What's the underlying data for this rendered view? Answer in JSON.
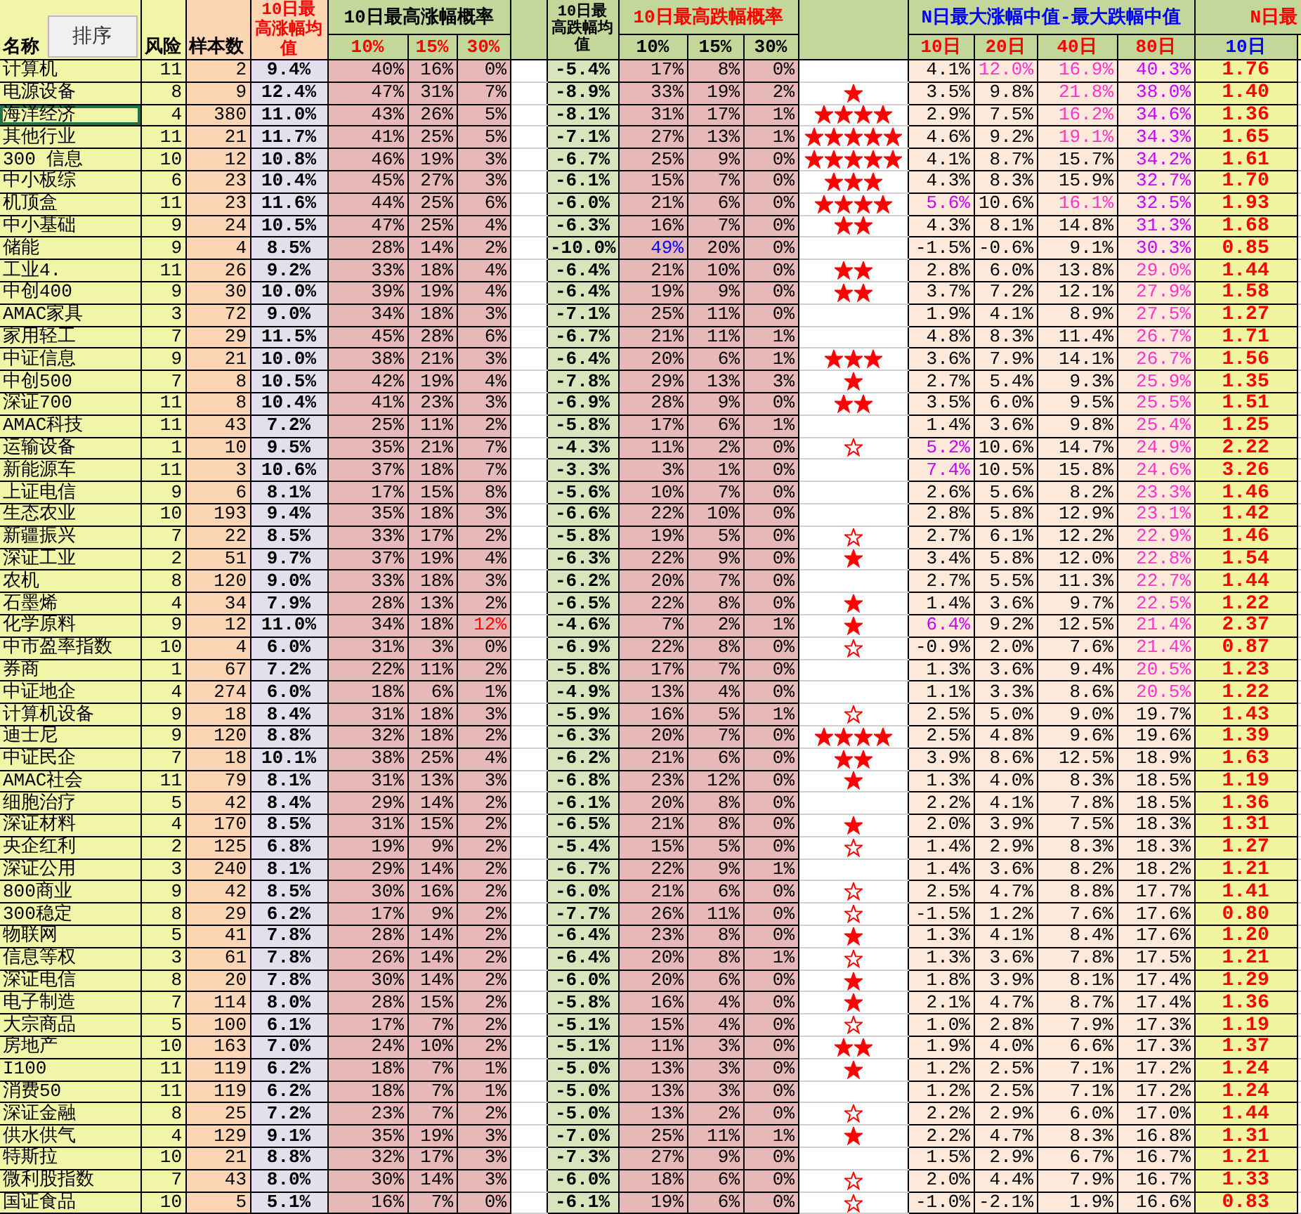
{
  "header": {
    "sort_button": "排序",
    "name": "名称",
    "risk": "风险",
    "count": "样本数",
    "up_mean": "10日最高涨幅均值",
    "up_prob": {
      "title": "10日最高涨幅概率",
      "cols": [
        "10%",
        "15%",
        "30%"
      ]
    },
    "down_mean": "10日最高跌幅均值",
    "down_prob": {
      "title": "10日最高跌幅概率",
      "cols": [
        "10%",
        "15%",
        "30%"
      ]
    },
    "median": {
      "title": "N日最大涨幅中值-最大跌幅中值",
      "cols": [
        "10日",
        "20日",
        "40日",
        "80日"
      ]
    },
    "ratio": {
      "title": "N日最",
      "cols": [
        "10日"
      ]
    }
  },
  "rows": [
    {
      "name": "计算机",
      "selected": false,
      "risk": "11",
      "count": "2",
      "up_mean": "9.4%",
      "up_prob": [
        "40%",
        "16%",
        "0%"
      ],
      "down_mean": "-5.4%",
      "down_prob": [
        "17%",
        "8%",
        "0%"
      ],
      "median": [
        "4.1%",
        {
          "text": "12.0%",
          "color": "#ff33cc"
        },
        {
          "text": "16.9%",
          "color": "#ff33cc"
        },
        {
          "text": "40.3%",
          "color": "#cc00ff"
        }
      ],
      "ratio": "1.76"
    },
    {
      "name": "电源设备",
      "selected": false,
      "risk": "8",
      "count": "9",
      "up_mean": "12.4%",
      "up_prob": [
        "47%",
        "31%",
        "7%"
      ],
      "down_mean": "-8.9%",
      "down_prob": [
        "33%",
        "19%",
        "2%"
      ],
      "star_icons": [
        {
          "filled": true
        }
      ],
      "median": [
        "3.5%",
        "9.8%",
        {
          "text": "21.8%",
          "color": "#ff33cc"
        },
        {
          "text": "38.0%",
          "color": "#cc00ff"
        }
      ],
      "ratio": "1.40"
    },
    {
      "name": "海洋经济",
      "selected": true,
      "risk": "4",
      "count": "380",
      "up_mean": "11.0%",
      "up_prob": [
        "43%",
        "26%",
        "5%"
      ],
      "down_mean": "-8.1%",
      "down_prob": [
        "31%",
        "17%",
        "1%"
      ],
      "star_icons": [
        {
          "filled": true
        },
        {
          "filled": true
        },
        {
          "filled": true
        },
        {
          "filled": true
        }
      ],
      "median": [
        "2.9%",
        "7.5%",
        {
          "text": "16.2%",
          "color": "#ff33cc"
        },
        {
          "text": "34.6%",
          "color": "#cc00ff"
        }
      ],
      "ratio": "1.36"
    },
    {
      "name": "其他行业",
      "selected": false,
      "risk": "11",
      "count": "21",
      "up_mean": "11.7%",
      "up_prob": [
        "41%",
        "25%",
        "5%"
      ],
      "down_mean": "-7.1%",
      "down_prob": [
        "27%",
        "13%",
        "1%"
      ],
      "star_icons": [
        {
          "filled": true
        },
        {
          "filled": true
        },
        {
          "filled": true
        },
        {
          "filled": true
        },
        {
          "filled": true
        }
      ],
      "median": [
        "4.6%",
        "9.2%",
        {
          "text": "19.1%",
          "color": "#ff33cc"
        },
        {
          "text": "34.3%",
          "color": "#cc00ff"
        }
      ],
      "ratio": "1.65"
    },
    {
      "name": "300 信息",
      "selected": false,
      "risk": "10",
      "count": "12",
      "up_mean": "10.8%",
      "up_prob": [
        "46%",
        "19%",
        "3%"
      ],
      "down_mean": "-6.7%",
      "down_prob": [
        "25%",
        "9%",
        "0%"
      ],
      "star_icons": [
        {
          "filled": true
        },
        {
          "filled": true
        },
        {
          "filled": true
        },
        {
          "filled": true
        },
        {
          "filled": true
        }
      ],
      "median": [
        "4.1%",
        "8.7%",
        "15.7%",
        {
          "text": "34.2%",
          "color": "#cc00ff"
        }
      ],
      "ratio": "1.61"
    },
    {
      "name": "中小板综",
      "selected": false,
      "risk": "6",
      "count": "23",
      "up_mean": "10.4%",
      "up_prob": [
        "45%",
        "27%",
        "3%"
      ],
      "down_mean": "-6.1%",
      "down_prob": [
        "15%",
        "7%",
        "0%"
      ],
      "star_icons": [
        {
          "filled": true
        },
        {
          "filled": true
        },
        {
          "filled": true
        }
      ],
      "median": [
        "4.3%",
        "8.3%",
        "15.9%",
        {
          "text": "32.7%",
          "color": "#cc00ff"
        }
      ],
      "ratio": "1.70"
    },
    {
      "name": "机顶盒",
      "selected": false,
      "risk": "11",
      "count": "23",
      "up_mean": "11.6%",
      "up_prob": [
        "44%",
        "25%",
        "6%"
      ],
      "down_mean": "-6.0%",
      "down_prob": [
        "21%",
        "6%",
        "0%"
      ],
      "star_icons": [
        {
          "filled": true
        },
        {
          "filled": true
        },
        {
          "filled": true
        },
        {
          "filled": true
        }
      ],
      "median": [
        {
          "text": "5.6%",
          "color": "#cc00ff"
        },
        "10.6%",
        {
          "text": "16.1%",
          "color": "#ff33cc"
        },
        {
          "text": "32.5%",
          "color": "#cc00ff"
        }
      ],
      "ratio": "1.93"
    },
    {
      "name": "中小基础",
      "selected": false,
      "risk": "9",
      "count": "24",
      "up_mean": "10.5%",
      "up_prob": [
        "47%",
        "25%",
        "4%"
      ],
      "down_mean": "-6.3%",
      "down_prob": [
        "16%",
        "7%",
        "0%"
      ],
      "star_icons": [
        {
          "filled": true
        },
        {
          "filled": true
        }
      ],
      "median": [
        "4.3%",
        "8.1%",
        "14.8%",
        {
          "text": "31.3%",
          "color": "#cc00ff"
        }
      ],
      "ratio": "1.68"
    },
    {
      "name": "储能",
      "selected": false,
      "risk": "9",
      "count": "4",
      "up_mean": "8.5%",
      "up_prob": [
        "28%",
        "14%",
        "2%"
      ],
      "down_mean": "-10.0%",
      "down_prob": [
        {
          "text": "49%",
          "color": "#0000ff"
        },
        "20%",
        "0%"
      ],
      "median": [
        "-1.5%",
        "-0.6%",
        "9.1%",
        {
          "text": "30.3%",
          "color": "#cc00ff"
        }
      ],
      "ratio": "0.85"
    },
    {
      "name": "工业4.",
      "selected": false,
      "risk": "11",
      "count": "26",
      "up_mean": "9.2%",
      "up_prob": [
        "33%",
        "18%",
        "4%"
      ],
      "down_mean": "-6.4%",
      "down_prob": [
        "21%",
        "10%",
        "0%"
      ],
      "star_icons": [
        {
          "filled": true
        },
        {
          "filled": true
        }
      ],
      "median": [
        "2.8%",
        "6.0%",
        "13.8%",
        {
          "text": "29.0%",
          "color": "#ff33cc"
        }
      ],
      "ratio": "1.44"
    },
    {
      "name": "中创400",
      "selected": false,
      "risk": "9",
      "count": "30",
      "up_mean": "10.0%",
      "up_prob": [
        "39%",
        "19%",
        "4%"
      ],
      "down_mean": "-6.4%",
      "down_prob": [
        "19%",
        "9%",
        "0%"
      ],
      "star_icons": [
        {
          "filled": true
        },
        {
          "filled": true
        }
      ],
      "median": [
        "3.7%",
        "7.2%",
        "12.1%",
        {
          "text": "27.9%",
          "color": "#ff33cc"
        }
      ],
      "ratio": "1.58"
    },
    {
      "name": "AMAC家具",
      "selected": false,
      "risk": "3",
      "count": "72",
      "up_mean": "9.0%",
      "up_prob": [
        "34%",
        "18%",
        "3%"
      ],
      "down_mean": "-7.1%",
      "down_prob": [
        "25%",
        "11%",
        "0%"
      ],
      "median": [
        "1.9%",
        "4.1%",
        "8.9%",
        {
          "text": "27.5%",
          "color": "#ff33cc"
        }
      ],
      "ratio": "1.27"
    },
    {
      "name": "家用轻工",
      "selected": false,
      "risk": "7",
      "count": "29",
      "up_mean": "11.5%",
      "up_prob": [
        "45%",
        "28%",
        "6%"
      ],
      "down_mean": "-6.7%",
      "down_prob": [
        "21%",
        "11%",
        "1%"
      ],
      "median": [
        "4.8%",
        "8.3%",
        "11.4%",
        {
          "text": "26.7%",
          "color": "#ff33cc"
        }
      ],
      "ratio": "1.71"
    },
    {
      "name": "中证信息",
      "selected": false,
      "risk": "9",
      "count": "21",
      "up_mean": "10.0%",
      "up_prob": [
        "38%",
        "21%",
        "3%"
      ],
      "down_mean": "-6.4%",
      "down_prob": [
        "20%",
        "6%",
        "1%"
      ],
      "star_icons": [
        {
          "filled": true
        },
        {
          "filled": true
        },
        {
          "filled": true
        }
      ],
      "median": [
        "3.6%",
        "7.9%",
        "14.1%",
        {
          "text": "26.7%",
          "color": "#ff33cc"
        }
      ],
      "ratio": "1.56"
    },
    {
      "name": "中创500",
      "selected": false,
      "risk": "7",
      "count": "8",
      "up_mean": "10.5%",
      "up_prob": [
        "42%",
        "19%",
        "4%"
      ],
      "down_mean": "-7.8%",
      "down_prob": [
        "29%",
        "13%",
        "3%"
      ],
      "star_icons": [
        {
          "filled": true
        }
      ],
      "median": [
        "2.7%",
        "5.4%",
        "9.3%",
        {
          "text": "25.9%",
          "color": "#ff33cc"
        }
      ],
      "ratio": "1.35"
    },
    {
      "name": "深证700",
      "selected": false,
      "risk": "11",
      "count": "8",
      "up_mean": "10.4%",
      "up_prob": [
        "41%",
        "23%",
        "3%"
      ],
      "down_mean": "-6.9%",
      "down_prob": [
        "28%",
        "9%",
        "0%"
      ],
      "star_icons": [
        {
          "filled": true
        },
        {
          "filled": true
        }
      ],
      "median": [
        "3.5%",
        "6.0%",
        "9.5%",
        {
          "text": "25.5%",
          "color": "#ff33cc"
        }
      ],
      "ratio": "1.51"
    },
    {
      "name": "AMAC科技",
      "selected": false,
      "risk": "11",
      "count": "43",
      "up_mean": "7.2%",
      "up_prob": [
        "25%",
        "11%",
        "2%"
      ],
      "down_mean": "-5.8%",
      "down_prob": [
        "17%",
        "6%",
        "1%"
      ],
      "median": [
        "1.4%",
        "3.6%",
        "9.8%",
        {
          "text": "25.4%",
          "color": "#ff33cc"
        }
      ],
      "ratio": "1.25"
    },
    {
      "name": "运输设备",
      "selected": false,
      "risk": "1",
      "count": "10",
      "up_mean": "9.5%",
      "up_prob": [
        "35%",
        "21%",
        "7%"
      ],
      "down_mean": "-4.3%",
      "down_prob": [
        "11%",
        "2%",
        "0%"
      ],
      "star_icons": [
        {
          "filled": false
        }
      ],
      "median": [
        {
          "text": "5.2%",
          "color": "#cc00ff"
        },
        "10.6%",
        "14.7%",
        {
          "text": "24.9%",
          "color": "#ff33cc"
        }
      ],
      "ratio": "2.22"
    },
    {
      "name": "新能源车",
      "selected": false,
      "risk": "11",
      "count": "3",
      "up_mean": "10.6%",
      "up_prob": [
        "37%",
        "18%",
        "7%"
      ],
      "down_mean": "-3.3%",
      "down_prob": [
        "3%",
        "1%",
        "0%"
      ],
      "median": [
        {
          "text": "7.4%",
          "color": "#cc00ff"
        },
        "10.5%",
        "15.8%",
        {
          "text": "24.6%",
          "color": "#ff33cc"
        }
      ],
      "ratio": "3.26"
    },
    {
      "name": "上证电信",
      "selected": false,
      "risk": "9",
      "count": "6",
      "up_mean": "8.1%",
      "up_prob": [
        "17%",
        "15%",
        "8%"
      ],
      "down_mean": "-5.6%",
      "down_prob": [
        "10%",
        "7%",
        "0%"
      ],
      "median": [
        "2.6%",
        "5.6%",
        "8.2%",
        {
          "text": "23.3%",
          "color": "#ff33cc"
        }
      ],
      "ratio": "1.46"
    },
    {
      "name": "生态农业",
      "selected": false,
      "risk": "10",
      "count": "193",
      "up_mean": "9.4%",
      "up_prob": [
        "35%",
        "18%",
        "3%"
      ],
      "down_mean": "-6.6%",
      "down_prob": [
        "22%",
        "10%",
        "0%"
      ],
      "median": [
        "2.8%",
        "5.8%",
        "12.9%",
        {
          "text": "23.1%",
          "color": "#ff33cc"
        }
      ],
      "ratio": "1.42"
    },
    {
      "name": "新疆振兴",
      "selected": false,
      "risk": "7",
      "count": "22",
      "up_mean": "8.5%",
      "up_prob": [
        "33%",
        "17%",
        "2%"
      ],
      "down_mean": "-5.8%",
      "down_prob": [
        "19%",
        "5%",
        "0%"
      ],
      "star_icons": [
        {
          "filled": false
        }
      ],
      "median": [
        "2.7%",
        "6.1%",
        "12.2%",
        {
          "text": "22.9%",
          "color": "#ff33cc"
        }
      ],
      "ratio": "1.46"
    },
    {
      "name": "深证工业",
      "selected": false,
      "risk": "2",
      "count": "51",
      "up_mean": "9.7%",
      "up_prob": [
        "37%",
        "19%",
        "4%"
      ],
      "down_mean": "-6.3%",
      "down_prob": [
        "22%",
        "9%",
        "0%"
      ],
      "star_icons": [
        {
          "filled": true
        }
      ],
      "median": [
        "3.4%",
        "5.8%",
        "12.0%",
        {
          "text": "22.8%",
          "color": "#ff33cc"
        }
      ],
      "ratio": "1.54"
    },
    {
      "name": "农机",
      "selected": false,
      "risk": "8",
      "count": "120",
      "up_mean": "9.0%",
      "up_prob": [
        "33%",
        "18%",
        "3%"
      ],
      "down_mean": "-6.2%",
      "down_prob": [
        "20%",
        "7%",
        "0%"
      ],
      "median": [
        "2.7%",
        "5.5%",
        "11.3%",
        {
          "text": "22.7%",
          "color": "#ff33cc"
        }
      ],
      "ratio": "1.44"
    },
    {
      "name": "石墨烯",
      "selected": false,
      "risk": "4",
      "count": "34",
      "up_mean": "7.9%",
      "up_prob": [
        "28%",
        "13%",
        "2%"
      ],
      "down_mean": "-6.5%",
      "down_prob": [
        "22%",
        "8%",
        "0%"
      ],
      "star_icons": [
        {
          "filled": true
        }
      ],
      "median": [
        "1.4%",
        "3.6%",
        "9.7%",
        {
          "text": "22.5%",
          "color": "#ff33cc"
        }
      ],
      "ratio": "1.22"
    },
    {
      "name": "化学原料",
      "selected": false,
      "risk": "9",
      "count": "12",
      "up_mean": "11.0%",
      "up_prob": [
        "34%",
        "18%",
        {
          "text": "12%",
          "color": "#ff0000"
        }
      ],
      "down_mean": "-4.6%",
      "down_prob": [
        "7%",
        "2%",
        "1%"
      ],
      "star_icons": [
        {
          "filled": true
        }
      ],
      "median": [
        {
          "text": "6.4%",
          "color": "#cc00ff"
        },
        "9.2%",
        "12.5%",
        {
          "text": "21.4%",
          "color": "#ff33cc"
        }
      ],
      "ratio": "2.37"
    },
    {
      "name": "中市盈率指数",
      "selected": false,
      "risk": "10",
      "count": "4",
      "up_mean": "6.0%",
      "up_prob": [
        "31%",
        "3%",
        "0%"
      ],
      "down_mean": "-6.9%",
      "down_prob": [
        "22%",
        "8%",
        "0%"
      ],
      "star_icons": [
        {
          "filled": false
        }
      ],
      "median": [
        "-0.9%",
        "2.0%",
        "7.6%",
        {
          "text": "21.4%",
          "color": "#ff33cc"
        }
      ],
      "ratio": "0.87"
    },
    {
      "name": "券商",
      "selected": false,
      "risk": "1",
      "count": "67",
      "up_mean": "7.2%",
      "up_prob": [
        "22%",
        "11%",
        "2%"
      ],
      "down_mean": "-5.8%",
      "down_prob": [
        "17%",
        "7%",
        "0%"
      ],
      "median": [
        "1.3%",
        "3.6%",
        "9.4%",
        {
          "text": "20.5%",
          "color": "#ff33cc"
        }
      ],
      "ratio": "1.23"
    },
    {
      "name": "中证地企",
      "selected": false,
      "risk": "4",
      "count": "274",
      "up_mean": "6.0%",
      "up_prob": [
        "18%",
        "6%",
        "1%"
      ],
      "down_mean": "-4.9%",
      "down_prob": [
        "13%",
        "4%",
        "0%"
      ],
      "median": [
        "1.1%",
        "3.3%",
        "8.6%",
        {
          "text": "20.5%",
          "color": "#ff33cc"
        }
      ],
      "ratio": "1.22"
    },
    {
      "name": "计算机设备",
      "selected": false,
      "risk": "9",
      "count": "18",
      "up_mean": "8.4%",
      "up_prob": [
        "31%",
        "18%",
        "3%"
      ],
      "down_mean": "-5.9%",
      "down_prob": [
        "16%",
        "5%",
        "1%"
      ],
      "star_icons": [
        {
          "filled": false
        }
      ],
      "median": [
        "2.5%",
        "5.0%",
        "9.0%",
        "19.7%"
      ],
      "ratio": "1.43"
    },
    {
      "name": "迪士尼",
      "selected": false,
      "risk": "9",
      "count": "120",
      "up_mean": "8.8%",
      "up_prob": [
        "32%",
        "18%",
        "2%"
      ],
      "down_mean": "-6.3%",
      "down_prob": [
        "20%",
        "7%",
        "0%"
      ],
      "star_icons": [
        {
          "filled": true
        },
        {
          "filled": true
        },
        {
          "filled": true
        },
        {
          "filled": true
        }
      ],
      "median": [
        "2.5%",
        "4.8%",
        "9.6%",
        "19.6%"
      ],
      "ratio": "1.39"
    },
    {
      "name": "中证民企",
      "selected": false,
      "risk": "7",
      "count": "18",
      "up_mean": "10.1%",
      "up_prob": [
        "38%",
        "25%",
        "4%"
      ],
      "down_mean": "-6.2%",
      "down_prob": [
        "21%",
        "6%",
        "0%"
      ],
      "star_icons": [
        {
          "filled": true
        },
        {
          "filled": true
        }
      ],
      "median": [
        "3.9%",
        "8.6%",
        "12.5%",
        "18.9%"
      ],
      "ratio": "1.63"
    },
    {
      "name": "AMAC社会",
      "selected": false,
      "risk": "11",
      "count": "79",
      "up_mean": "8.1%",
      "up_prob": [
        "31%",
        "13%",
        "3%"
      ],
      "down_mean": "-6.8%",
      "down_prob": [
        "23%",
        "12%",
        "0%"
      ],
      "star_icons": [
        {
          "filled": true
        }
      ],
      "median": [
        "1.3%",
        "4.0%",
        "8.3%",
        "18.5%"
      ],
      "ratio": "1.19"
    },
    {
      "name": "细胞治疗",
      "selected": false,
      "risk": "5",
      "count": "42",
      "up_mean": "8.4%",
      "up_prob": [
        "29%",
        "14%",
        "2%"
      ],
      "down_mean": "-6.1%",
      "down_prob": [
        "20%",
        "8%",
        "0%"
      ],
      "median": [
        "2.2%",
        "4.1%",
        "7.8%",
        "18.5%"
      ],
      "ratio": "1.36"
    },
    {
      "name": "深证材料",
      "selected": false,
      "risk": "4",
      "count": "170",
      "up_mean": "8.5%",
      "up_prob": [
        "31%",
        "15%",
        "2%"
      ],
      "down_mean": "-6.5%",
      "down_prob": [
        "21%",
        "8%",
        "0%"
      ],
      "star_icons": [
        {
          "filled": true
        }
      ],
      "median": [
        "2.0%",
        "3.9%",
        "7.5%",
        "18.3%"
      ],
      "ratio": "1.31"
    },
    {
      "name": "央企红利",
      "selected": false,
      "risk": "2",
      "count": "125",
      "up_mean": "6.8%",
      "up_prob": [
        "19%",
        "9%",
        "2%"
      ],
      "down_mean": "-5.4%",
      "down_prob": [
        "15%",
        "5%",
        "0%"
      ],
      "star_icons": [
        {
          "filled": false
        }
      ],
      "median": [
        "1.4%",
        "2.9%",
        "8.3%",
        "18.3%"
      ],
      "ratio": "1.27"
    },
    {
      "name": "深证公用",
      "selected": false,
      "risk": "3",
      "count": "240",
      "up_mean": "8.1%",
      "up_prob": [
        "29%",
        "14%",
        "2%"
      ],
      "down_mean": "-6.7%",
      "down_prob": [
        "22%",
        "9%",
        "1%"
      ],
      "median": [
        "1.4%",
        "3.6%",
        "8.2%",
        "18.2%"
      ],
      "ratio": "1.21"
    },
    {
      "name": "800商业",
      "selected": false,
      "risk": "9",
      "count": "42",
      "up_mean": "8.5%",
      "up_prob": [
        "30%",
        "16%",
        "2%"
      ],
      "down_mean": "-6.0%",
      "down_prob": [
        "21%",
        "6%",
        "0%"
      ],
      "star_icons": [
        {
          "filled": false
        }
      ],
      "median": [
        "2.5%",
        "4.7%",
        "8.8%",
        "17.7%"
      ],
      "ratio": "1.41"
    },
    {
      "name": "300稳定",
      "selected": false,
      "risk": "8",
      "count": "29",
      "up_mean": "6.2%",
      "up_prob": [
        "17%",
        "9%",
        "2%"
      ],
      "down_mean": "-7.7%",
      "down_prob": [
        "26%",
        "11%",
        "0%"
      ],
      "star_icons": [
        {
          "filled": false
        }
      ],
      "median": [
        "-1.5%",
        "1.2%",
        "7.6%",
        "17.6%"
      ],
      "ratio": "0.80"
    },
    {
      "name": "物联网",
      "selected": false,
      "risk": "5",
      "count": "41",
      "up_mean": "7.8%",
      "up_prob": [
        "28%",
        "14%",
        "2%"
      ],
      "down_mean": "-6.4%",
      "down_prob": [
        "23%",
        "8%",
        "0%"
      ],
      "star_icons": [
        {
          "filled": true
        }
      ],
      "median": [
        "1.3%",
        "4.1%",
        "8.4%",
        "17.6%"
      ],
      "ratio": "1.20"
    },
    {
      "name": "信息等权",
      "selected": false,
      "risk": "3",
      "count": "61",
      "up_mean": "7.8%",
      "up_prob": [
        "26%",
        "14%",
        "2%"
      ],
      "down_mean": "-6.4%",
      "down_prob": [
        "20%",
        "8%",
        "1%"
      ],
      "star_icons": [
        {
          "filled": false
        }
      ],
      "median": [
        "1.3%",
        "3.6%",
        "7.8%",
        "17.5%"
      ],
      "ratio": "1.21"
    },
    {
      "name": "深证电信",
      "selected": false,
      "risk": "8",
      "count": "20",
      "up_mean": "7.8%",
      "up_prob": [
        "30%",
        "14%",
        "2%"
      ],
      "down_mean": "-6.0%",
      "down_prob": [
        "20%",
        "6%",
        "0%"
      ],
      "star_icons": [
        {
          "filled": true
        }
      ],
      "median": [
        "1.8%",
        "3.9%",
        "8.1%",
        "17.4%"
      ],
      "ratio": "1.29"
    },
    {
      "name": "电子制造",
      "selected": false,
      "risk": "7",
      "count": "114",
      "up_mean": "8.0%",
      "up_prob": [
        "28%",
        "15%",
        "2%"
      ],
      "down_mean": "-5.8%",
      "down_prob": [
        "16%",
        "4%",
        "0%"
      ],
      "star_icons": [
        {
          "filled": true
        }
      ],
      "median": [
        "2.1%",
        "4.7%",
        "8.7%",
        "17.4%"
      ],
      "ratio": "1.36"
    },
    {
      "name": "大宗商品",
      "selected": false,
      "risk": "5",
      "count": "100",
      "up_mean": "6.1%",
      "up_prob": [
        "17%",
        "7%",
        "2%"
      ],
      "down_mean": "-5.1%",
      "down_prob": [
        "15%",
        "4%",
        "0%"
      ],
      "star_icons": [
        {
          "filled": false
        }
      ],
      "median": [
        "1.0%",
        "2.8%",
        "7.9%",
        "17.3%"
      ],
      "ratio": "1.19"
    },
    {
      "name": "房地产",
      "selected": false,
      "risk": "10",
      "count": "163",
      "up_mean": "7.0%",
      "up_prob": [
        "24%",
        "10%",
        "2%"
      ],
      "down_mean": "-5.1%",
      "down_prob": [
        "11%",
        "3%",
        "0%"
      ],
      "star_icons": [
        {
          "filled": true
        },
        {
          "filled": true
        }
      ],
      "median": [
        "1.9%",
        "4.0%",
        "6.6%",
        "17.3%"
      ],
      "ratio": "1.37"
    },
    {
      "name": "I100",
      "selected": false,
      "risk": "11",
      "count": "119",
      "up_mean": "6.2%",
      "up_prob": [
        "18%",
        "7%",
        "1%"
      ],
      "down_mean": "-5.0%",
      "down_prob": [
        "13%",
        "3%",
        "0%"
      ],
      "star_icons": [
        {
          "filled": true
        }
      ],
      "median": [
        "1.2%",
        "2.5%",
        "7.1%",
        "17.2%"
      ],
      "ratio": "1.24"
    },
    {
      "name": "消费50",
      "selected": false,
      "risk": "11",
      "count": "119",
      "up_mean": "6.2%",
      "up_prob": [
        "18%",
        "7%",
        "1%"
      ],
      "down_mean": "-5.0%",
      "down_prob": [
        "13%",
        "3%",
        "0%"
      ],
      "median": [
        "1.2%",
        "2.5%",
        "7.1%",
        "17.2%"
      ],
      "ratio": "1.24"
    },
    {
      "name": "深证金融",
      "selected": false,
      "risk": "8",
      "count": "25",
      "up_mean": "7.2%",
      "up_prob": [
        "23%",
        "7%",
        "2%"
      ],
      "down_mean": "-5.0%",
      "down_prob": [
        "13%",
        "2%",
        "0%"
      ],
      "star_icons": [
        {
          "filled": false
        }
      ],
      "median": [
        "2.2%",
        "2.9%",
        "6.0%",
        "17.0%"
      ],
      "ratio": "1.44"
    },
    {
      "name": "供水供气",
      "selected": false,
      "risk": "4",
      "count": "129",
      "up_mean": "9.1%",
      "up_prob": [
        "35%",
        "19%",
        "3%"
      ],
      "down_mean": "-7.0%",
      "down_prob": [
        "25%",
        "11%",
        "1%"
      ],
      "star_icons": [
        {
          "filled": true
        }
      ],
      "median": [
        "2.2%",
        "4.7%",
        "8.3%",
        "16.8%"
      ],
      "ratio": "1.31"
    },
    {
      "name": "特斯拉",
      "selected": false,
      "risk": "10",
      "count": "21",
      "up_mean": "8.8%",
      "up_prob": [
        "32%",
        "17%",
        "3%"
      ],
      "down_mean": "-7.3%",
      "down_prob": [
        "27%",
        "9%",
        "0%"
      ],
      "median": [
        "1.5%",
        "2.9%",
        "6.7%",
        "16.7%"
      ],
      "ratio": "1.21"
    },
    {
      "name": "微利股指数",
      "selected": false,
      "risk": "7",
      "count": "43",
      "up_mean": "8.0%",
      "up_prob": [
        "30%",
        "14%",
        "3%"
      ],
      "down_mean": "-6.0%",
      "down_prob": [
        "18%",
        "6%",
        "0%"
      ],
      "star_icons": [
        {
          "filled": false
        }
      ],
      "median": [
        "2.0%",
        "4.4%",
        "7.9%",
        "16.7%"
      ],
      "ratio": "1.33"
    },
    {
      "name": "国证食品",
      "selected": false,
      "risk": "10",
      "count": "5",
      "up_mean": "5.1%",
      "up_prob": [
        "16%",
        "7%",
        "0%"
      ],
      "down_mean": "-6.1%",
      "down_prob": [
        "19%",
        "6%",
        "0%"
      ],
      "star_icons": [
        {
          "filled": false
        }
      ],
      "median": [
        "-1.0%",
        "-2.1%",
        "1.9%",
        "16.6%"
      ],
      "ratio": "0.83"
    }
  ]
}
